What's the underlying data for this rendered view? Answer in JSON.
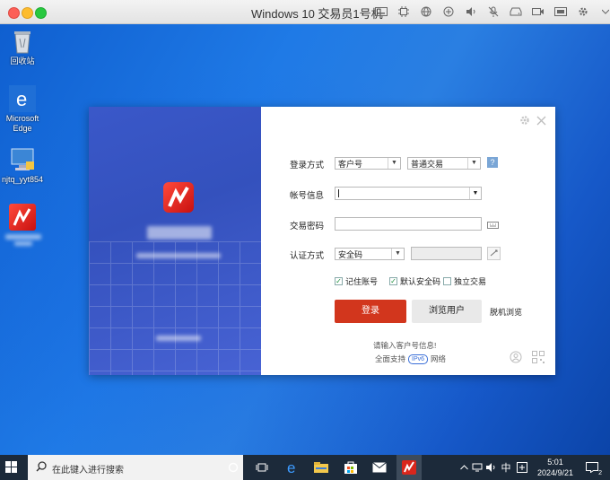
{
  "window": {
    "title": "Windows 10 交易员1号机"
  },
  "desktop_icons": [
    {
      "label": "回收站"
    },
    {
      "label": "Microsoft Edge"
    },
    {
      "label": "njtq_yyt854"
    }
  ],
  "dialog": {
    "rows": {
      "login_method": {
        "label": "登录方式",
        "type_value": "客户号",
        "mode_value": "普通交易",
        "help": "?"
      },
      "account": {
        "label": "帐号信息",
        "value": ""
      },
      "password": {
        "label": "交易密码",
        "value": ""
      },
      "auth": {
        "label": "认证方式",
        "value": "安全码"
      }
    },
    "checkboxes": [
      {
        "label": "记住账号",
        "checked": true
      },
      {
        "label": "默认安全码",
        "checked": true
      },
      {
        "label": "独立交易",
        "checked": false
      }
    ],
    "login_label": "登录",
    "browse_label": "浏览用户",
    "offline_label": "脱机浏览",
    "hint": "请输入客户号信息!",
    "network_prefix": "全面支持",
    "ipv6_badge": "IPv6",
    "network_suffix": "网络",
    "colors": {
      "login": "#d2361d",
      "accent": "#3a58c9"
    }
  },
  "taskbar": {
    "search_placeholder": "在此键入进行搜索",
    "ime": "中",
    "time": "5:01",
    "date": "2024/9/21",
    "notification_count": "2"
  }
}
